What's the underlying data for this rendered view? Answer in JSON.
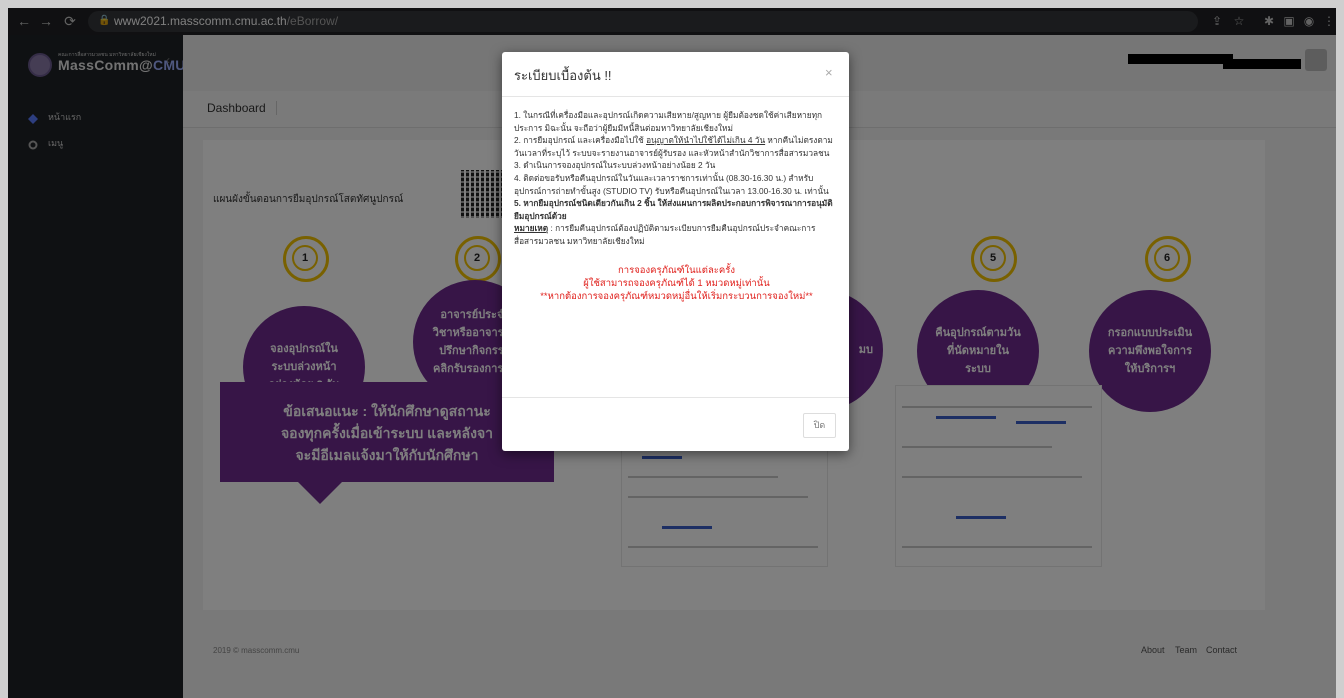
{
  "browser": {
    "url_host": "www2021.masscomm.cmu.ac.th",
    "url_path": "/eBorrow/"
  },
  "brand": {
    "small": "คณะการสื่อสารมวลชน มหาวิทยาลัยเชียงใหม่",
    "name_main": "MassComm@",
    "name_accent": "CMU"
  },
  "sidebar": {
    "items": [
      {
        "label": "หน้าแรก",
        "icon": "diamond-icon"
      },
      {
        "label": "เมนู",
        "icon": "cogs-icon"
      }
    ]
  },
  "breadcrumb": "Dashboard",
  "card": {
    "title": "แผนผังขั้นตอนการยืมอุปกรณ์โสตทัศนูปกรณ์",
    "steps": [
      {
        "num": "1",
        "text": "จองอุปกรณ์ในระบบล่วงหน้าอย่างน้อย 2 วัน"
      },
      {
        "num": "2",
        "text": "อาจารย์ประจำวิชาหรืออาจารย์ที่ปรึกษากิจกรรมคลิกรับรองการยืม"
      },
      {
        "num": "5",
        "text": "คืนอุปกรณ์ตามวันที่นัดหมายในระบบ"
      },
      {
        "num": "6",
        "text": "กรอกแบบประเมินความพึงพอใจการให้บริการฯ"
      }
    ],
    "partial_step_text": [
      "ม",
      "บ"
    ],
    "advice_lines": [
      "ข้อเสนอแนะ : ให้นักศึกษาดูสถานะ",
      "จองทุกครั้งเมื่อเข้าระบบ และหลังจา",
      "จะมีอีเมลแจ้งมาให้กับนักศึกษา"
    ]
  },
  "footer": {
    "copyright": "2019 © masscomm.cmu",
    "links": [
      "About",
      "Team",
      "Contact"
    ]
  },
  "modal": {
    "title": "ระเบียบเบื้องต้น !!",
    "close": "×",
    "rules": {
      "r1": "1. ในกรณีที่เครื่องมือและอุปกรณ์เกิดความเสียหาย/สูญหาย ผู้ยืมต้องชดใช้ค่าเสียหายทุกประการ มิฉะนั้น จะถือว่าผู้ยืมมีหนี้สินต่อมหาวิทยาลัยเชียงใหม่",
      "r2_a": "2. การยืมอุปกรณ์ และเครื่องมือไปใช้ ",
      "r2_u": "อนุญาตให้นำไปใช้ได้ไม่เกิน 4 วัน",
      "r2_b": " หากคืนไม่ตรงตามวันเวลาที่ระบุไว้ ระบบจะรายงานอาจารย์ผู้รับรอง และหัวหน้าสำนักวิชาการสื่อสารมวลชน",
      "r3": "3. ดำเนินการจองอุปกรณ์ในระบบล่วงหน้าอย่างน้อย 2 วัน",
      "r4": "4. ติดต่อขอรับหรือคืนอุปกรณ์ในวันและเวลาราชการเท่านั้น (08.30-16.30 น.) สำหรับอุปกรณ์การถ่ายทำขั้นสูง (STUDIO TV) รับหรือคืนอุปกรณ์ในเวลา 13.00-16.30 น. เท่านั้น",
      "r5": "5. หากยืมอุปกรณ์ชนิดเดียวกันเกิน 2 ชิ้น ให้ส่งแผนการผลิตประกอบการพิจารณาการอนุมัติยืมอุปกรณ์ด้วย",
      "note_label": "หมายเหตุ",
      "note_text": " : การยืมคืนอุปกรณ์ต้องปฏิบัติตามระเบียบการยืมคืนอุปกรณ์ประจำคณะการสื่อสารมวลชน มหาวิทยาลัยเชียงใหม่"
    },
    "warning": {
      "l1": "การจองครุภัณฑ์ในแต่ละครั้ง",
      "l2": "ผู้ใช้สามารถจองครุภัณฑ์ได้ 1 หมวดหมู่เท่านั้น",
      "l3": "**หากต้องการจองครุภัณฑ์หมวดหมู่อื่นให้เริ่มกระบวนการจองใหม่**"
    },
    "ok_button": "ปิด"
  },
  "colors": {
    "purple": "#6e2a8e",
    "yellow": "#f2c200",
    "warning_red": "#e0201c"
  }
}
